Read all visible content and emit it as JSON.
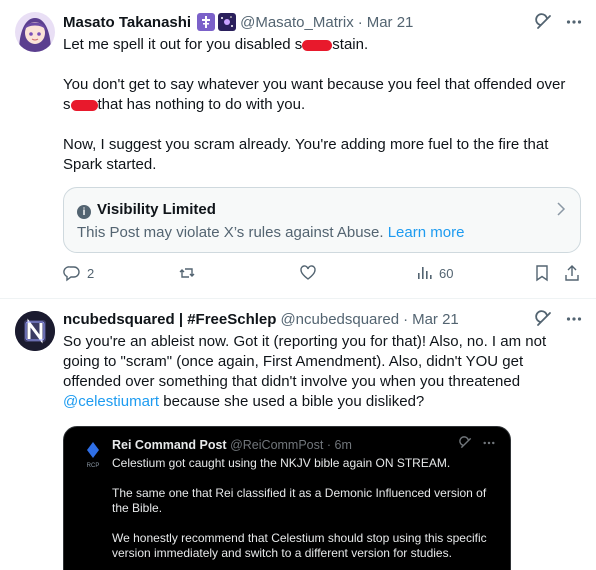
{
  "tweet1": {
    "author_name": "Masato Takanashi",
    "handle": "@Masato_Matrix",
    "date": "Mar 21",
    "text_line1_before": "Let me spell it out for you disabled s",
    "text_line1_after": "stain.",
    "text_para2_line1": "You don't get to say whatever you want because you feel that offended over",
    "text_para2_line2_before": "s",
    "text_para2_line2_after": "that has nothing to do with you.",
    "text_para3": "Now, I suggest you scram already. You're adding more fuel to the fire that Spark started.",
    "visibility": {
      "title": "Visibility Limited",
      "body": "This Post may violate X’s rules against Abuse.",
      "link": "Learn more"
    },
    "actions": {
      "replies": "2",
      "views": "60"
    }
  },
  "tweet2": {
    "author_name": "ncubedsquared | #FreeSchlep",
    "handle": "@ncubedsquared",
    "date": "Mar 21",
    "text_before_mention": "So you're an ableist now. Got it (reporting you for that)! Also, no. I am not going to \"scram\" (once again, First Amendment). Also, didn't YOU get offended over something that didn't involve you when you threatened ",
    "mention": "@celestiumart",
    "text_after_mention": " because she used a bible you disliked?",
    "embedded": {
      "author_name": "Rei Command Post",
      "handle": "@ReiCommPost",
      "time": "6m",
      "para1": "Celestium got caught using the NKJV bible again ON STREAM.",
      "para2": "The same one that Rei classified it as a Demonic Influenced version of the Bible.",
      "para3": "We honestly recommend that Celestium should stop using this specific version immediately and switch to a different version for studies."
    }
  },
  "colors": {
    "accent": "#1d9bf0",
    "muted": "#536471",
    "redaction": "#e8192c"
  },
  "icons": [
    "grok-icon",
    "more-icon",
    "reply-icon",
    "repost-icon",
    "like-icon",
    "views-icon",
    "bookmark-icon",
    "share-icon",
    "info-icon",
    "chevron-right-icon"
  ]
}
